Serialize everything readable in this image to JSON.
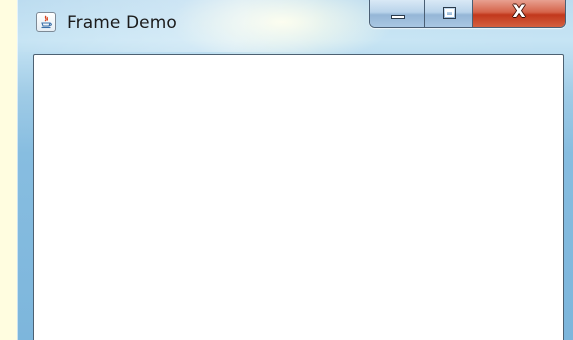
{
  "window": {
    "title": "Frame Demo",
    "icon": "java-cup-icon",
    "controls": {
      "minimize": "minimize-icon",
      "maximize": "maximize-icon",
      "close": "close-icon"
    }
  },
  "colors": {
    "background": "#fffde0",
    "frame_accent": "#87bde0",
    "close_button": "#c2381c",
    "content": "#ffffff"
  }
}
